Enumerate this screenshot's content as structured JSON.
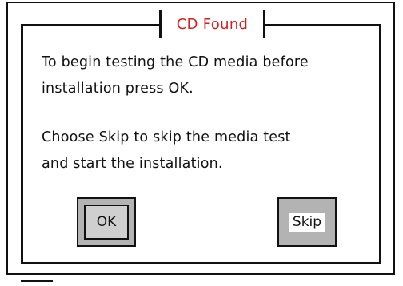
{
  "dialog": {
    "title": "CD Found",
    "message_1_line_1": "To begin testing the CD media before",
    "message_1_line_2": "installation press OK.",
    "message_2_line_1": "Choose Skip to skip the media test",
    "message_2_line_2": "and start the installation."
  },
  "buttons": {
    "ok_label": "OK",
    "skip_label": "Skip"
  },
  "colors": {
    "title": "#d61e1e",
    "background": "#ffffff",
    "button_face": "#b3b3b3",
    "border": "#111111"
  }
}
